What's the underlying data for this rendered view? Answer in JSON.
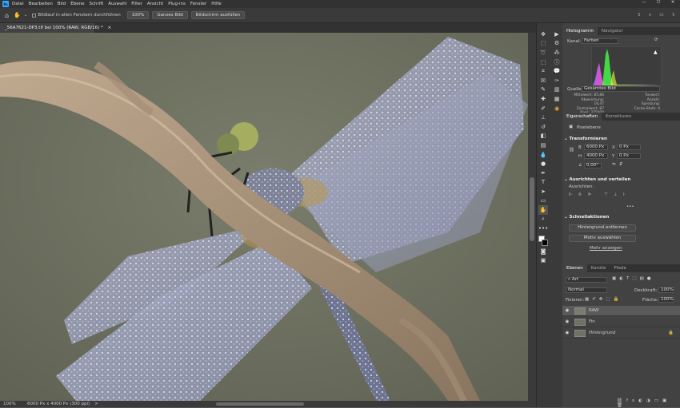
{
  "app": {
    "logo": "Ps"
  },
  "menu": [
    "Datei",
    "Bearbeiten",
    "Bild",
    "Ebene",
    "Schrift",
    "Auswahl",
    "Filter",
    "Ansicht",
    "Plug-ins",
    "Fenster",
    "Hilfe"
  ],
  "window_controls": [
    "—",
    "☐",
    "✕"
  ],
  "options": {
    "scroll_all_label": "Bildlauf in allen Fenstern durchführen",
    "zoom_100": "100%",
    "fit": "Ganzes Bild",
    "fill": "Bildschirm ausfüllen"
  },
  "document": {
    "tab_title": "_56A7621-DP3.tif bei 100% (RAW, RGB/16) *",
    "close": "×"
  },
  "status": {
    "zoom": "100%",
    "info": "6000 Px x 4000 Px (300 ppi)",
    "arrow": ">"
  },
  "panels": {
    "histogram": {
      "tabs": [
        "Histogramm",
        "Navigator"
      ],
      "channel_label": "Kanal:",
      "channel_value": "Farben",
      "source_label": "Quelle:",
      "source_value": "Gesamtes Bild",
      "stats_left": [
        [
          "Mittelwert:",
          "85,86"
        ],
        [
          "Abweichung:",
          "16,47"
        ],
        [
          "Zentralwert:",
          "87"
        ],
        [
          "Pixel:",
          "375000"
        ]
      ],
      "stats_right": [
        [
          "Tonwert:",
          ""
        ],
        [
          "Anzahl:",
          ""
        ],
        [
          "Spreizung:",
          ""
        ],
        [
          "Cache-Stufe:",
          "4"
        ]
      ]
    },
    "properties": {
      "tabs": [
        "Eigenschaften",
        "Korrekturen"
      ],
      "kind": "Pixelebene",
      "transform_title": "Transformieren",
      "w": "6000 Px",
      "h": "4000 Px",
      "x": "0 Px",
      "y": "0 Px",
      "angle": "0,00°",
      "w_label": "B",
      "h_label": "H",
      "x_label": "X",
      "y_label": "Y",
      "align_title": "Ausrichten und verteilen",
      "align_sub": "Ausrichten:",
      "more": "•••",
      "quick_title": "Schnellaktionen",
      "btn1": "Hintergrund entfernen",
      "btn2": "Motiv auswählen",
      "link": "Mehr anzeigen"
    },
    "layers": {
      "tabs": [
        "Ebenen",
        "Kanäle",
        "Pfade"
      ],
      "filter": "Art",
      "blend": "Normal",
      "opacity_label": "Deckkraft:",
      "opacity": "100%",
      "fill_label": "Fläche:",
      "fill": "100%",
      "lock_label": "Fixieren:",
      "items": [
        {
          "name": "RAW",
          "selected": true
        },
        {
          "name": "Fin",
          "selected": false
        },
        {
          "name": "Hintergrund",
          "selected": false
        }
      ]
    }
  },
  "colors": {
    "accent": "#31a8ff",
    "canvas_bg": "#6f7261"
  }
}
